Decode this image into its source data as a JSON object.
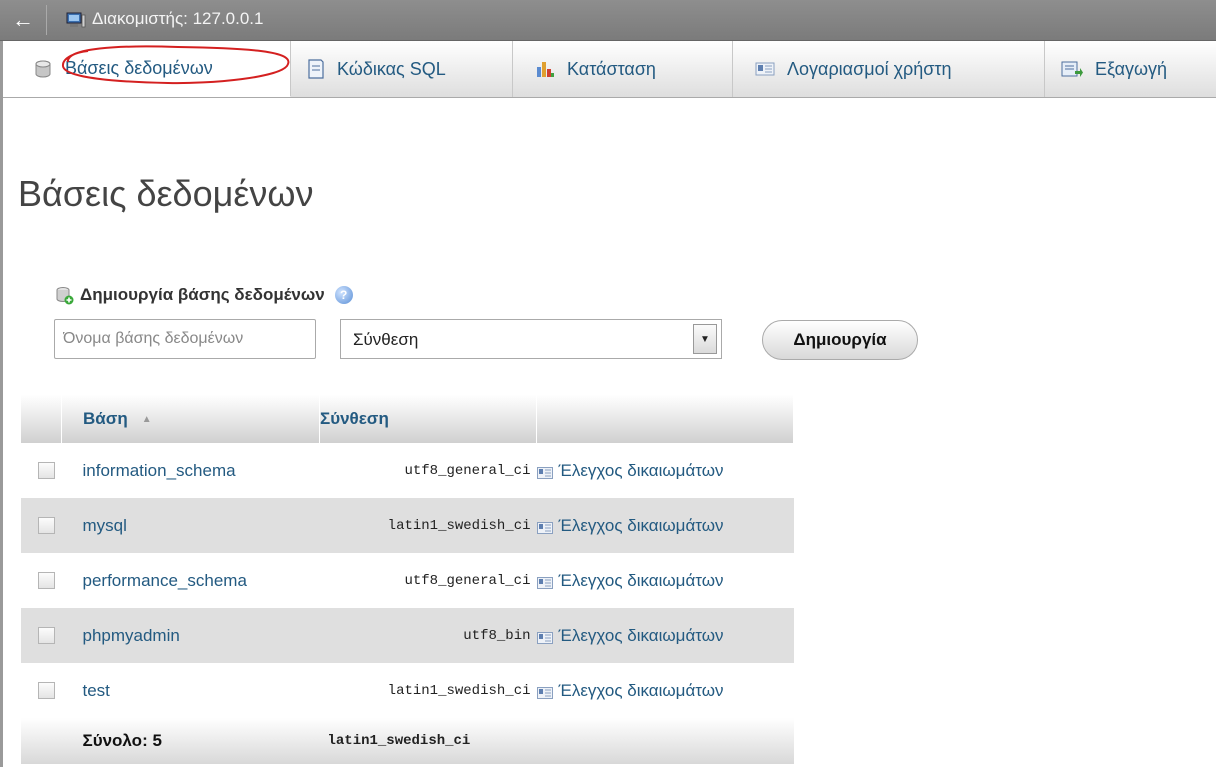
{
  "serverbar": {
    "back_glyph": "←",
    "server_label": "Διακομιστής: 127.0.0.1"
  },
  "tabs": [
    {
      "label": "Βάσεις δεδομένων",
      "icon": "database-icon",
      "active": true
    },
    {
      "label": "Κώδικας SQL",
      "icon": "sql-icon"
    },
    {
      "label": "Κατάσταση",
      "icon": "status-chart-icon"
    },
    {
      "label": "Λογαριασμοί χρήστη",
      "icon": "user-accounts-icon"
    },
    {
      "label": "Εξαγωγή",
      "icon": "export-icon"
    }
  ],
  "annotation_color": "#d42020",
  "page": {
    "title": "Βάσεις δεδομένων"
  },
  "create": {
    "heading": "Δημιουργία βάσης δεδομένων",
    "name_placeholder": "Όνομα βάσης δεδομένων",
    "collation_value": "Σύνθεση",
    "button_label": "Δημιουργία"
  },
  "table": {
    "headers": {
      "name": "Βάση",
      "collation": "Σύνθεση"
    },
    "action_label": "Έλεγχος δικαιωμάτων",
    "rows": [
      {
        "name": "information_schema",
        "collation": "utf8_general_ci"
      },
      {
        "name": "mysql",
        "collation": "latin1_swedish_ci"
      },
      {
        "name": "performance_schema",
        "collation": "utf8_general_ci"
      },
      {
        "name": "phpmyadmin",
        "collation": "utf8_bin"
      },
      {
        "name": "test",
        "collation": "latin1_swedish_ci"
      }
    ],
    "total": {
      "label": "Σύνολο: 5",
      "collation": "latin1_swedish_ci"
    }
  },
  "colors": {
    "link": "#235a81",
    "bar": "#8a8a8a"
  }
}
